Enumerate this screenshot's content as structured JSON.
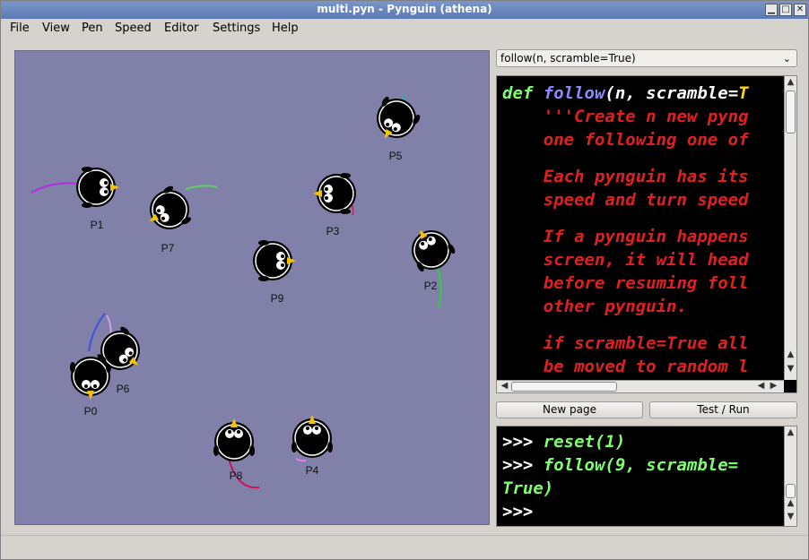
{
  "window": {
    "title": "multi.pyn  - Pynguin (athena)",
    "controls": [
      "minimize-icon",
      "maximize-icon",
      "close-icon"
    ]
  },
  "menubar": {
    "items": [
      "File",
      "View",
      "Pen",
      "Speed",
      "Editor",
      "Settings",
      "Help"
    ]
  },
  "canvas": {
    "background": "#8080a8",
    "pynguins": [
      "P0",
      "P1",
      "P2",
      "P3",
      "P4",
      "P5",
      "P6",
      "P7",
      "P8",
      "P9"
    ]
  },
  "editor": {
    "function_selector": "follow(n, scramble=True)",
    "code_line1": {
      "kw": "def",
      "fn": "follow",
      "args": "(n, scramble=",
      "default": "T"
    },
    "doc_lines": [
      "    '''Create n new pyng",
      "    one following one of",
      "",
      "    Each pynguin has its",
      "    speed and turn speed",
      "",
      "    If a pynguin happens",
      "    screen, it will head",
      "    before resuming foll",
      "    other pynguin.",
      "",
      "    if scramble=True all",
      "    be moved to random l"
    ]
  },
  "buttons": {
    "new_page": "New page",
    "test_run": "Test / Run"
  },
  "console": {
    "prompt": ">>>",
    "lines": [
      {
        "prompt": ">>>",
        "text": "reset(1)"
      },
      {
        "prompt": ">>>",
        "text": "follow(9, scramble="
      },
      {
        "prompt": "",
        "text": "True)"
      },
      {
        "prompt": ">>>",
        "text": ""
      }
    ]
  },
  "colors": {
    "keyword": "#7cff6a",
    "function": "#8888ff",
    "docstring": "#e02020",
    "default_value": "#ffd800",
    "canvas": "#8080a8"
  }
}
